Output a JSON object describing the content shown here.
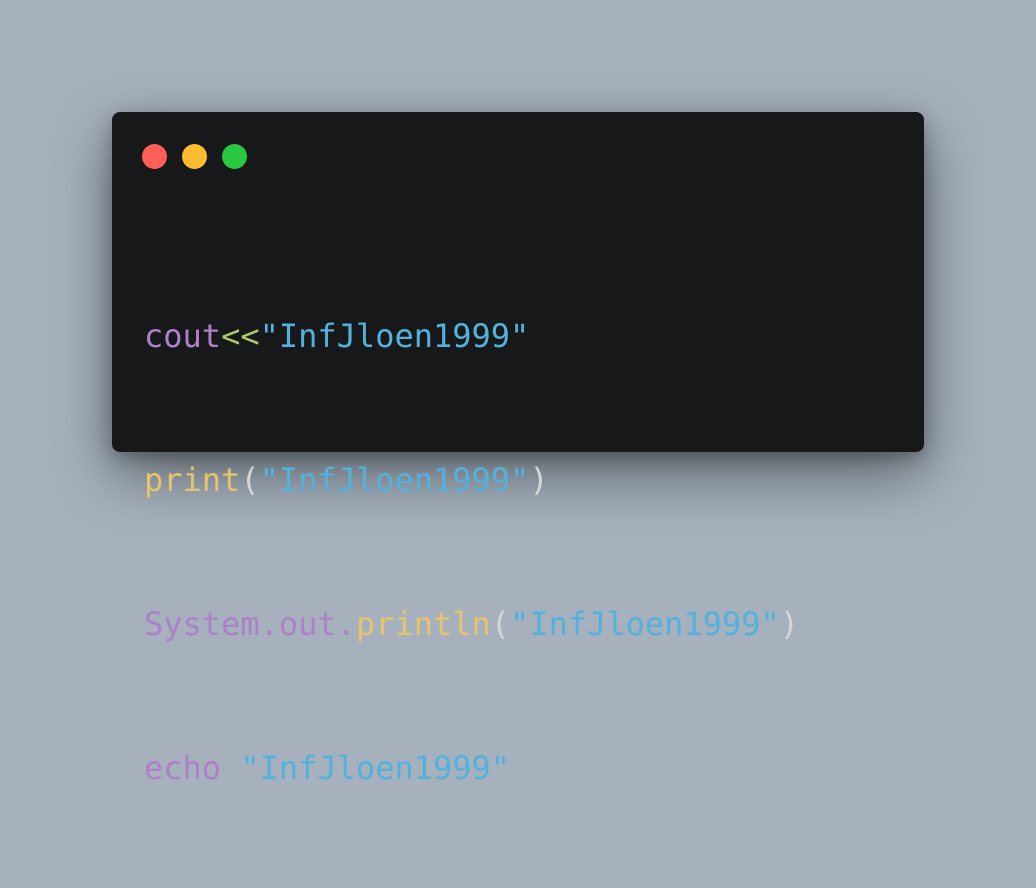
{
  "window": {
    "controls": [
      {
        "name": "close",
        "color": "#ff5f57"
      },
      {
        "name": "minimize",
        "color": "#febc2e"
      },
      {
        "name": "maximize",
        "color": "#28c840"
      }
    ]
  },
  "code": {
    "line1": {
      "ident": "cout",
      "op": "<<",
      "str": "\"InfJloen1999\""
    },
    "line2": {
      "fn": "print",
      "open": "(",
      "str": "\"InfJloen1999\"",
      "close": ")"
    },
    "line3": {
      "obj": "System.out.",
      "fn": "println",
      "open": "(",
      "str": "\"InfJloen1999\"",
      "close": ")"
    },
    "line4": {
      "kw": "echo",
      "space": " ",
      "str": "\"InfJloen1999\""
    }
  },
  "colors": {
    "background": "#a6b1bd",
    "editor": "#17181a",
    "keyword": "#ae80c7",
    "function": "#e6c46d",
    "operator": "#a9cb6b",
    "string": "#52b2dc",
    "punctuation": "#d6d6d6"
  }
}
